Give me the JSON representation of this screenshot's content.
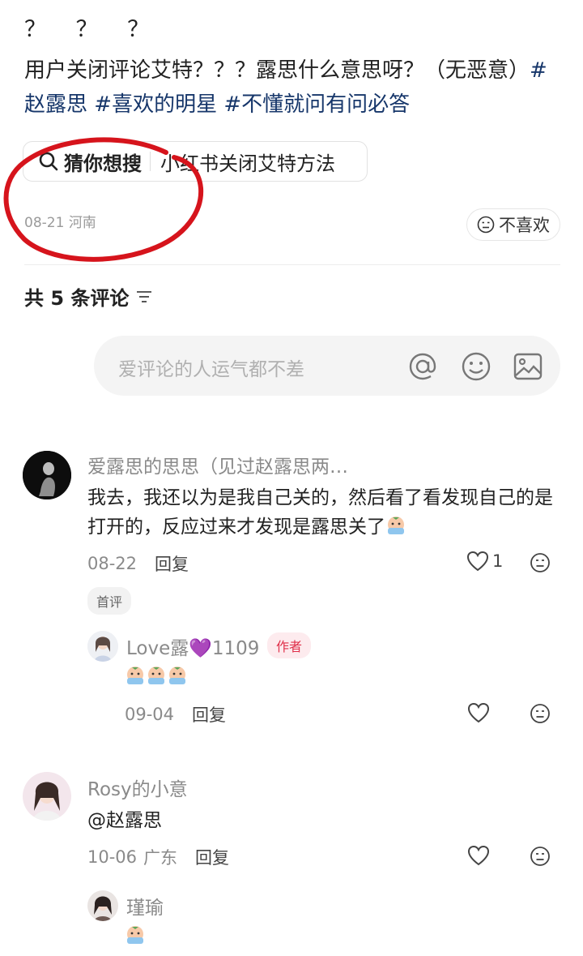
{
  "post": {
    "question_marks": "？ ？ ？",
    "text_plain": "用户关闭评论艾特？？？露思什么意思呀？（无恶意）",
    "tags": [
      "#赵露思",
      "#喜欢的明星",
      "#不懂就问有问必答"
    ],
    "search_chip": {
      "label": "猜你想搜",
      "query": "小红书关闭艾特方法"
    },
    "date": "08-21",
    "location": "河南",
    "dislike_label": "不喜欢"
  },
  "comments_header": {
    "count_text": "共 5 条评论"
  },
  "comment_input": {
    "placeholder": "爱评论的人运气都不差"
  },
  "comments": [
    {
      "user": "爱露思的思思（见过赵露思两…",
      "text": "我去，我还以为是我自己关的，然后看了看发现自己的是打开的，反应过来才发现是露思关了",
      "date": "08-22",
      "reply_label": "回复",
      "likes": "1",
      "badge": "首评"
    },
    {
      "user": "Love露💜1109",
      "badge": "作者",
      "date": "09-04",
      "reply_label": "回复"
    },
    {
      "user": "Rosy的小意",
      "text": "@赵露思",
      "date": "10-06",
      "location": "广东",
      "reply_label": "回复"
    },
    {
      "user": "瑾瑜"
    }
  ],
  "colors": {
    "tag": "#16366a",
    "author_badge": "#e0304a",
    "annotation": "#d6141c"
  }
}
